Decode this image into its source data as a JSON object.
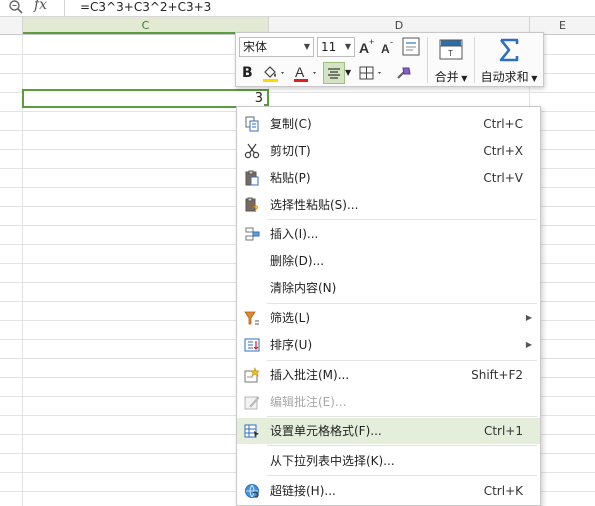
{
  "formula_bar": {
    "formula": "=C3^3+C3^2+C3+3",
    "fx_label": "fx"
  },
  "columns": [
    {
      "label": "C",
      "selected": true
    },
    {
      "label": "D",
      "selected": false
    },
    {
      "label": "E",
      "selected": false
    }
  ],
  "active_cell": {
    "value": "3"
  },
  "toolbar": {
    "font_name": "宋体",
    "font_size": "11",
    "merge_label": "合并",
    "autosum_label": "自动求和",
    "bold_label": "B",
    "font_color_label": "A"
  },
  "context_menu": {
    "items": [
      {
        "label": "复制(C)",
        "shortcut": "Ctrl+C",
        "icon": "copy-icon"
      },
      {
        "label": "剪切(T)",
        "shortcut": "Ctrl+X",
        "icon": "scissors-icon"
      },
      {
        "label": "粘贴(P)",
        "shortcut": "Ctrl+V",
        "icon": "paste-icon"
      },
      {
        "label": "选择性粘贴(S)...",
        "shortcut": "",
        "icon": "paste-special-icon"
      },
      {
        "label": "插入(I)...",
        "shortcut": "",
        "icon": "insert-icon"
      },
      {
        "label": "删除(D)...",
        "shortcut": "",
        "icon": ""
      },
      {
        "label": "清除内容(N)",
        "shortcut": "",
        "icon": ""
      },
      {
        "label": "筛选(L)",
        "shortcut": "",
        "icon": "filter-icon",
        "submenu": true
      },
      {
        "label": "排序(U)",
        "shortcut": "",
        "icon": "sort-icon",
        "submenu": true
      },
      {
        "label": "插入批注(M)...",
        "shortcut": "Shift+F2",
        "icon": "insert-comment-icon"
      },
      {
        "label": "编辑批注(E)...",
        "shortcut": "",
        "icon": "edit-comment-icon",
        "disabled": true
      },
      {
        "label": "设置单元格格式(F)...",
        "shortcut": "Ctrl+1",
        "icon": "format-cells-icon",
        "highlight": true
      },
      {
        "label": "从下拉列表中选择(K)...",
        "shortcut": "",
        "icon": ""
      },
      {
        "label": "超链接(H)...",
        "shortcut": "Ctrl+K",
        "icon": "hyperlink-icon"
      }
    ]
  },
  "colors": {
    "accent_green": "#5d9b3f",
    "highlight": "#e4eedb",
    "font_color_bar": "#e02020",
    "fill_color_bar": "#ffd800"
  }
}
